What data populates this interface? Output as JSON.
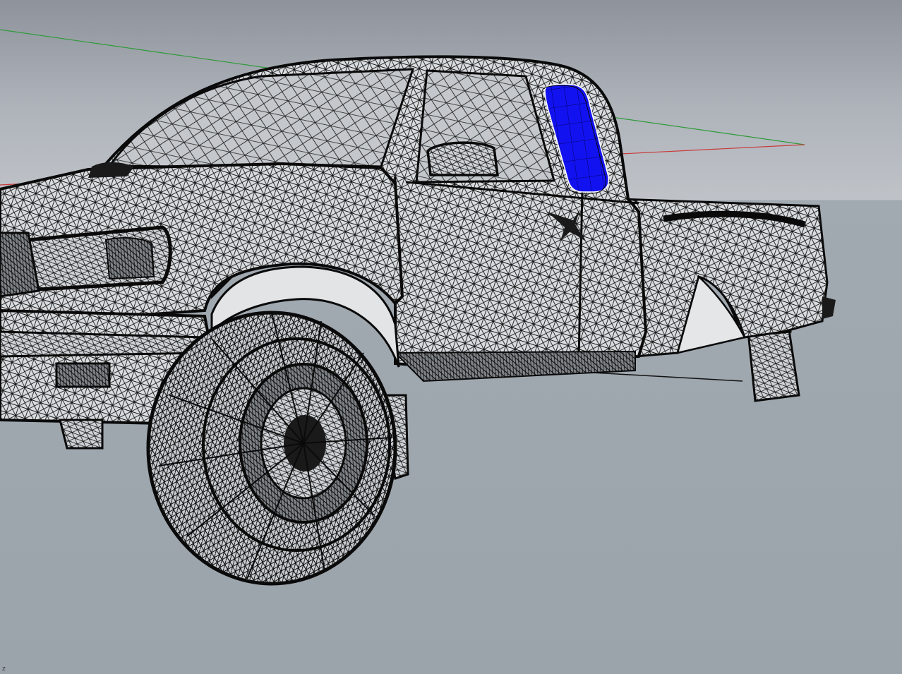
{
  "viewport": {
    "axis_label": "z"
  },
  "model": {
    "selected_part": "rear-quarter-window"
  },
  "colors": {
    "background_top": "#8e939b",
    "ground": "#9ba3ab",
    "wire": "#111111",
    "selection": "#1a1aff",
    "x_axis": "#c83a3a",
    "y_axis": "#2f9a3a"
  }
}
